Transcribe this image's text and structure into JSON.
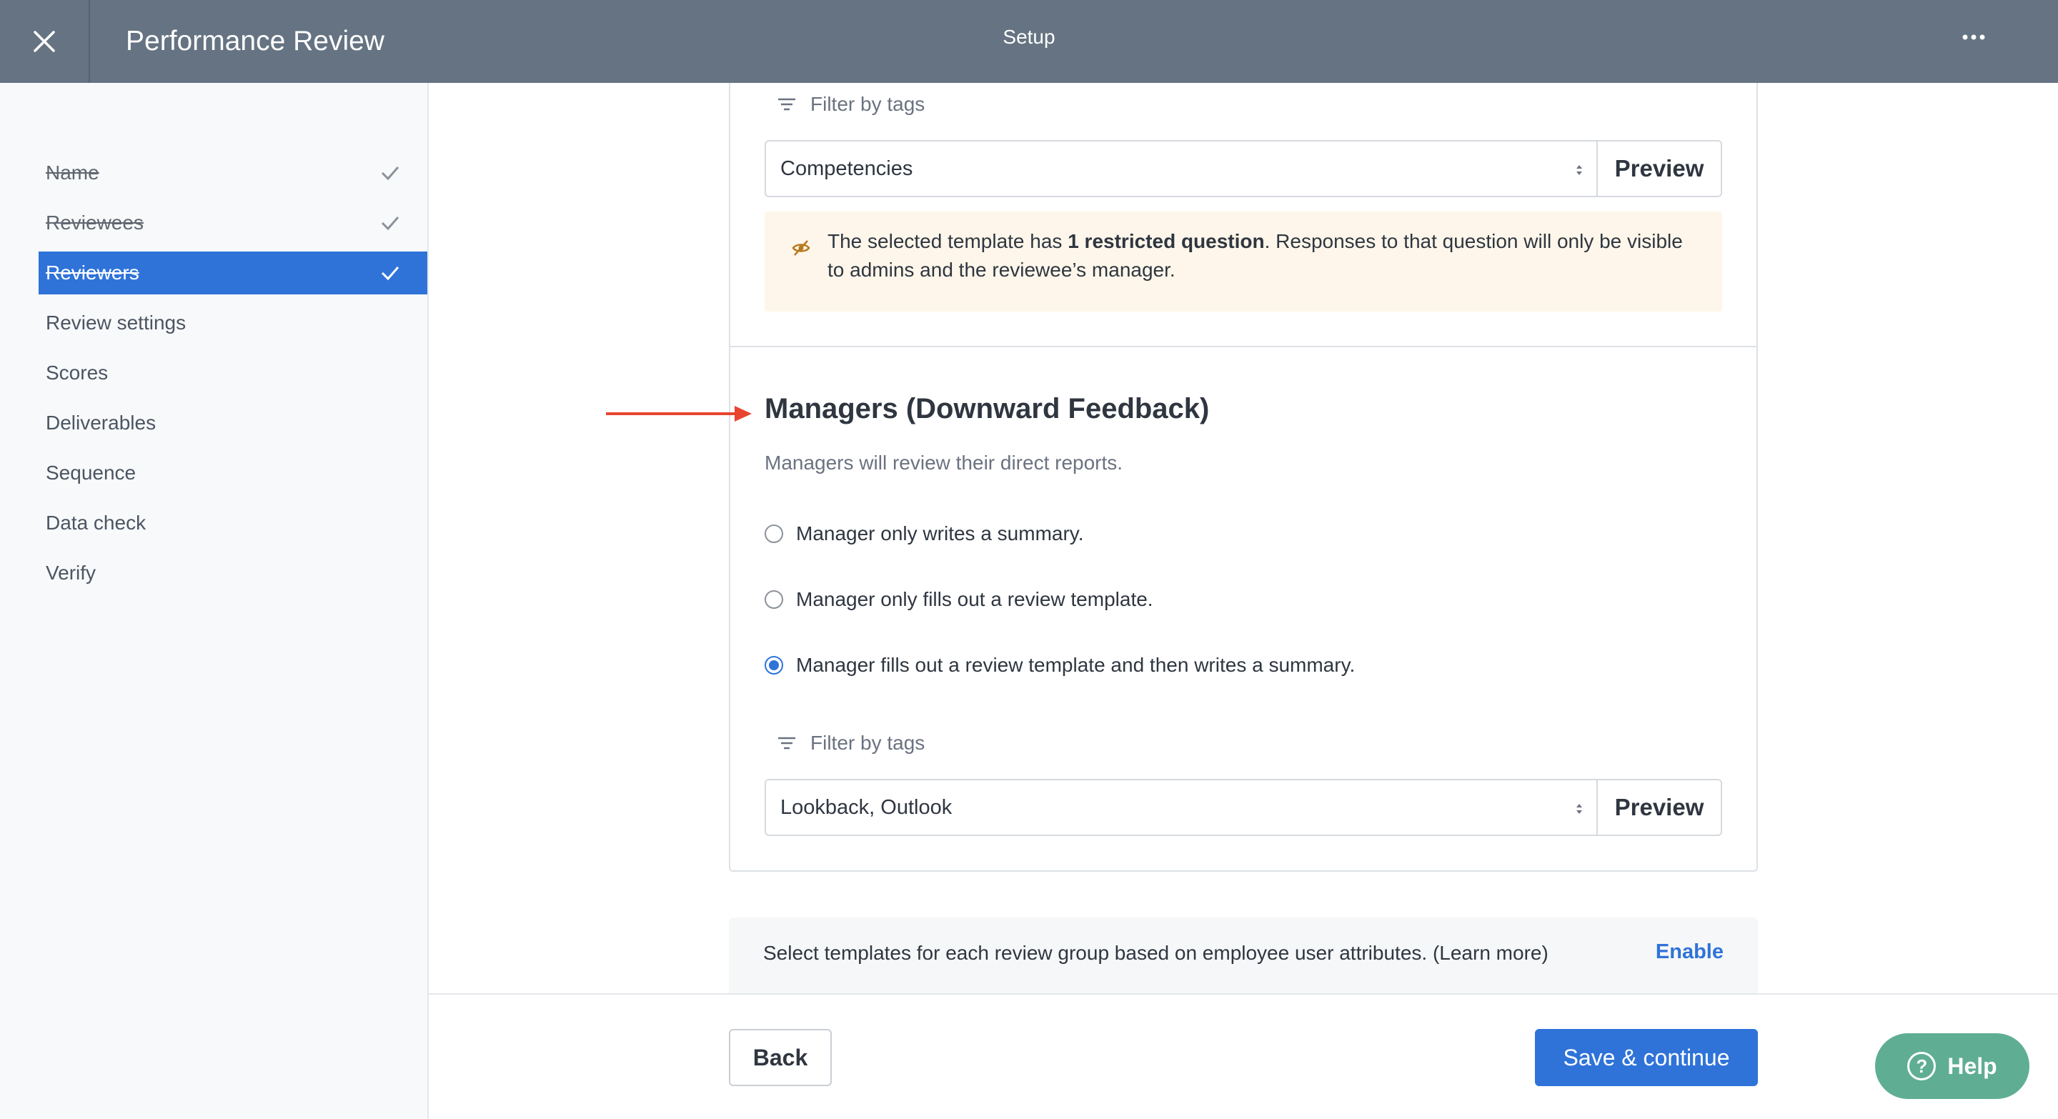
{
  "header": {
    "title": "Performance Review",
    "step": "Setup",
    "close_icon": "close-icon",
    "more_icon": "more-horizontal-icon",
    "bg_color": "#657382"
  },
  "sidebar": {
    "active_color": "#2f73d9",
    "items": [
      {
        "label": "Name",
        "status": "done"
      },
      {
        "label": "Reviewees",
        "status": "done"
      },
      {
        "label": "Reviewers",
        "status": "active"
      },
      {
        "label": "Review settings",
        "status": "pending"
      },
      {
        "label": "Scores",
        "status": "pending"
      },
      {
        "label": "Deliverables",
        "status": "pending"
      },
      {
        "label": "Sequence",
        "status": "pending"
      },
      {
        "label": "Data check",
        "status": "pending"
      },
      {
        "label": "Verify",
        "status": "pending"
      }
    ]
  },
  "upper_section": {
    "filter_label": "Filter by tags",
    "selected_template": "Competencies",
    "preview_label": "Preview",
    "warning": {
      "prefix": "The selected template has ",
      "bold": "1 restricted question",
      "suffix": ". Responses to that question will only be visible to admins and the reviewee’s manager."
    }
  },
  "managers_section": {
    "title": "Managers (Downward Feedback)",
    "description": "Managers will review their direct reports.",
    "options": [
      {
        "label": "Manager only writes a summary.",
        "checked": false
      },
      {
        "label": "Manager only fills out a review template.",
        "checked": false
      },
      {
        "label": "Manager fills out a review template and then writes a summary.",
        "checked": true
      }
    ],
    "filter_label": "Filter by tags",
    "selected_template": "Lookback, Outlook",
    "preview_label": "Preview"
  },
  "info_bar": {
    "text": "Select templates for each review group based on employee user attributes. (Learn more)",
    "action": "Enable"
  },
  "footer": {
    "back_label": "Back",
    "save_label": "Save & continue"
  },
  "help": {
    "label": "Help",
    "glyph": "?",
    "color": "#5fae94"
  }
}
